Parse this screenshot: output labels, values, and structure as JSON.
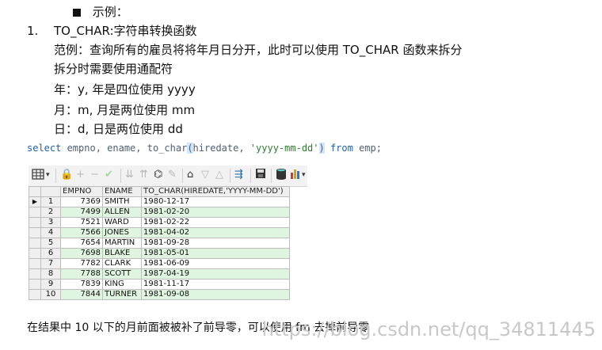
{
  "doc": {
    "example_label": "示例：",
    "item_number": "1.",
    "item_title": "TO_CHAR:字符串转换函数",
    "desc_line1": "范例：查询所有的雇员将将年月日分开，此时可以使用 TO_CHAR 函数来拆分",
    "desc_line2": "拆分时需要使用通配符",
    "year_line": "年：y,  年是四位使用 yyyy",
    "month_line": "月：m,  月是两位使用 mm",
    "day_line": "日：d,     日是两位使用 dd",
    "sql": {
      "select": "select",
      "cols": " empno, ename, to_char",
      "open": "(",
      "arg": "hiredate, ",
      "fmt": "'yyyy-mm-dd'",
      "close": ")",
      "from": " from",
      "table": " emp;"
    },
    "footer_text": "在结果中 10 以下的月前面被被补了前导零，可以使用 fm 去掉前导零",
    "watermark": "https://blog.csdn.net/qq_34811445"
  },
  "toolbar": {
    "grid_icon": "grid-icon",
    "lock_icon": "lock-icon",
    "add_icon": "add-icon",
    "remove_icon": "remove-icon",
    "check_icon": "check-icon",
    "filter_icon": "filter-icon",
    "find_icon": "binoculars-icon",
    "clear_icon": "eraser-icon",
    "nav_icon": "navigate-icon",
    "down_icon": "arrow-down-icon",
    "up_icon": "arrow-up-icon",
    "link_icon": "link-icon",
    "save_icon": "save-icon",
    "db_icon": "database-icon",
    "chart_icon": "chart-icon"
  },
  "grid": {
    "columns": [
      "EMPNO",
      "ENAME",
      "TO_CHAR(HIREDATE,'YYYY-MM-DD')"
    ],
    "rows": [
      {
        "n": "1",
        "empno": "7369",
        "ename": "SMITH",
        "date": "1980-12-17"
      },
      {
        "n": "2",
        "empno": "7499",
        "ename": "ALLEN",
        "date": "1981-02-20"
      },
      {
        "n": "3",
        "empno": "7521",
        "ename": "WARD",
        "date": "1981-02-22"
      },
      {
        "n": "4",
        "empno": "7566",
        "ename": "JONES",
        "date": "1981-04-02"
      },
      {
        "n": "5",
        "empno": "7654",
        "ename": "MARTIN",
        "date": "1981-09-28"
      },
      {
        "n": "6",
        "empno": "7698",
        "ename": "BLAKE",
        "date": "1981-05-01"
      },
      {
        "n": "7",
        "empno": "7782",
        "ename": "CLARK",
        "date": "1981-06-09"
      },
      {
        "n": "8",
        "empno": "7788",
        "ename": "SCOTT",
        "date": "1987-04-19"
      },
      {
        "n": "9",
        "empno": "7839",
        "ename": "KING",
        "date": "1981-11-17"
      },
      {
        "n": "10",
        "empno": "7844",
        "ename": "TURNER",
        "date": "1981-09-08"
      }
    ]
  }
}
